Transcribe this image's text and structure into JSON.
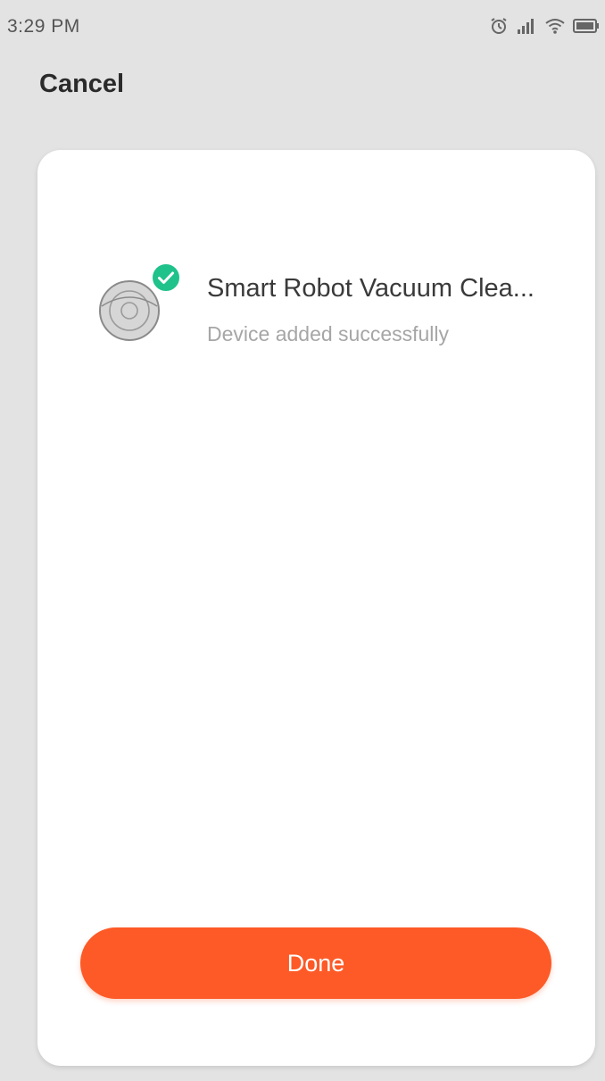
{
  "status_bar": {
    "time": "3:29 PM",
    "icons": [
      "alarm-icon",
      "signal-icon",
      "wifi-icon",
      "battery-icon"
    ]
  },
  "header": {
    "cancel_label": "Cancel"
  },
  "device": {
    "name": "Smart Robot Vacuum Clea...",
    "status": "Device added successfully",
    "icon": "robot-vacuum-icon",
    "badge_icon": "check-circle-icon"
  },
  "actions": {
    "done_label": "Done"
  },
  "colors": {
    "background": "#e3e3e3",
    "card": "#ffffff",
    "accent": "#fd5a27",
    "success": "#1fc28b",
    "title_text": "#3a3a3a",
    "secondary_text": "#a6a6a6"
  }
}
